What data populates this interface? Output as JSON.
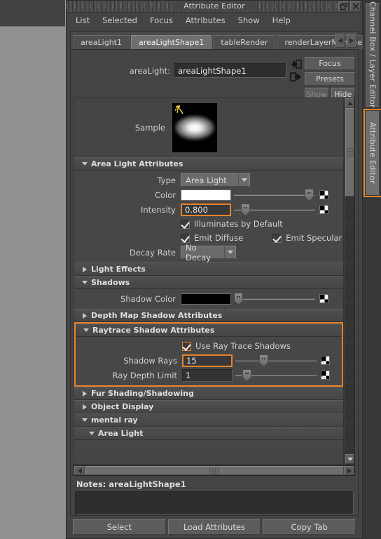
{
  "window": {
    "title": "Attribute Editor",
    "buttons": {
      "restore": "restore-icon",
      "close": "close-icon"
    }
  },
  "menubar": {
    "items": [
      {
        "label": "List"
      },
      {
        "label": "Selected"
      },
      {
        "label": "Focus"
      },
      {
        "label": "Attributes"
      },
      {
        "label": "Show"
      },
      {
        "label": "Help"
      }
    ]
  },
  "tabs": {
    "items": [
      {
        "label": "areaLight1",
        "active": false
      },
      {
        "label": "areaLightShape1",
        "active": true
      },
      {
        "label": "tableRender",
        "active": false
      },
      {
        "label": "renderLayerManager",
        "active": false
      }
    ],
    "prev_icon": "chevron-left-icon",
    "next_icon": "chevron-right-icon"
  },
  "node": {
    "type_label": "areaLight:",
    "name_value": "areaLightShape1",
    "in_arrow_icon": "input-connection-icon",
    "out_arrow_icon": "output-connection-icon"
  },
  "side_buttons": {
    "focus": "Focus",
    "presets": "Presets",
    "show": "Show",
    "hide": "Hide"
  },
  "sample": {
    "label": "Sample",
    "icon": "light-pick-icon"
  },
  "sections": {
    "area_light_attributes": {
      "title": "Area Light Attributes",
      "expanded": true,
      "type": {
        "label": "Type",
        "value": "Area Light"
      },
      "color": {
        "label": "Color",
        "value": "#ffffff",
        "slider_pct": 100
      },
      "intensity": {
        "label": "Intensity",
        "value": "0.800",
        "slider_pct": 12,
        "highlighted": true
      },
      "illuminates_by_default": {
        "label": "Illuminates by Default",
        "checked": true
      },
      "emit_diffuse": {
        "label": "Emit Diffuse",
        "checked": true
      },
      "emit_specular": {
        "label": "Emit Specular",
        "checked": true
      },
      "decay_rate": {
        "label": "Decay Rate",
        "value": "No Decay"
      }
    },
    "light_effects": {
      "title": "Light Effects",
      "expanded": false
    },
    "shadows": {
      "title": "Shadows",
      "expanded": true,
      "shadow_color": {
        "label": "Shadow Color",
        "value": "#000000",
        "slider_pct": 0
      }
    },
    "depth_map_shadow_attributes": {
      "title": "Depth Map Shadow Attributes",
      "expanded": false
    },
    "raytrace_shadow_attributes": {
      "title": "Raytrace Shadow Attributes",
      "expanded": true,
      "highlighted": true,
      "use_ray_trace_shadows": {
        "label": "Use Ray Trace Shadows",
        "checked": true,
        "highlighted": true
      },
      "shadow_rays": {
        "label": "Shadow Rays",
        "value": "15",
        "slider_pct": 30,
        "highlighted": true
      },
      "ray_depth_limit": {
        "label": "Ray Depth Limit",
        "value": "1",
        "slider_pct": 12
      }
    },
    "fur_shading_shadowing": {
      "title": "Fur Shading/Shadowing",
      "expanded": false
    },
    "object_display": {
      "title": "Object Display",
      "expanded": false
    },
    "mental_ray": {
      "title": "mental ray",
      "expanded": true
    },
    "area_light": {
      "title": "Area Light",
      "expanded": true
    }
  },
  "notes": {
    "label": "Notes:  areaLightShape1",
    "value": ""
  },
  "bottom_buttons": {
    "select": "Select",
    "load_attributes": "Load Attributes",
    "copy_tab": "Copy Tab"
  },
  "rail": {
    "tabs": [
      {
        "label": "Channel Box / Layer Editor",
        "selected": false
      },
      {
        "label": "Attribute Editor",
        "selected": true,
        "highlighted": true
      }
    ]
  },
  "colors": {
    "accent_orange": "#e8832a",
    "panel_bg": "#444444",
    "field_bg": "#333333",
    "text": "#d2d2d2"
  }
}
